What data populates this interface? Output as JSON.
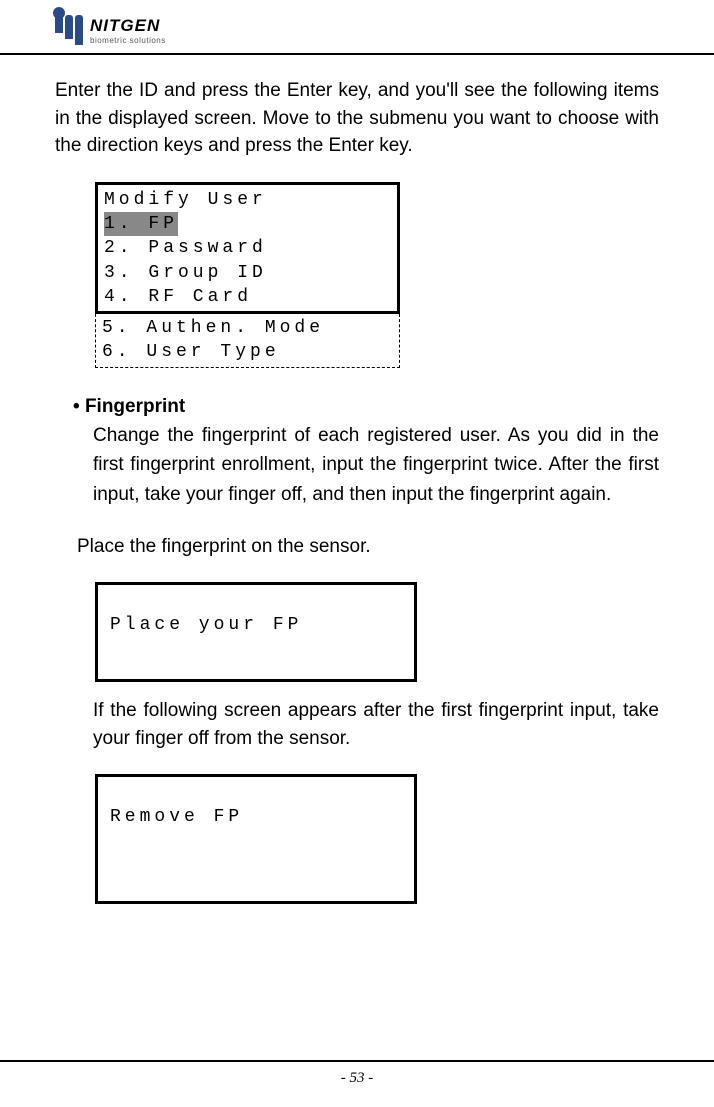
{
  "header": {
    "logo_name": "NITGEN",
    "logo_sub": "biometric solutions"
  },
  "content": {
    "para1": "Enter the ID and press the Enter key, and you'll see the following items in the displayed screen. Move to the submenu you want to choose with the direction keys and press the Enter key.",
    "menu": {
      "title": "Modify User",
      "items_top": [
        "1. FP",
        "2. Passward",
        "3. Group ID",
        "4. RF Card"
      ],
      "items_bottom": [
        "5. Authen. Mode",
        "6. User Type"
      ],
      "highlighted_index": 0
    },
    "section": {
      "heading": "Fingerprint",
      "para": "Change the fingerprint of each registered user. As you did in the first fingerprint enrollment, input the fingerprint twice. After the first input, take your finger off, and then input the fingerprint again.",
      "sub_para": "Place the fingerprint on the sensor.",
      "lcd1": "Place your FP",
      "para_after": "If the following screen appears after the first fingerprint input, take your finger off from the sensor.",
      "lcd2": "Remove FP"
    }
  },
  "footer": {
    "page": "- 53 -"
  }
}
